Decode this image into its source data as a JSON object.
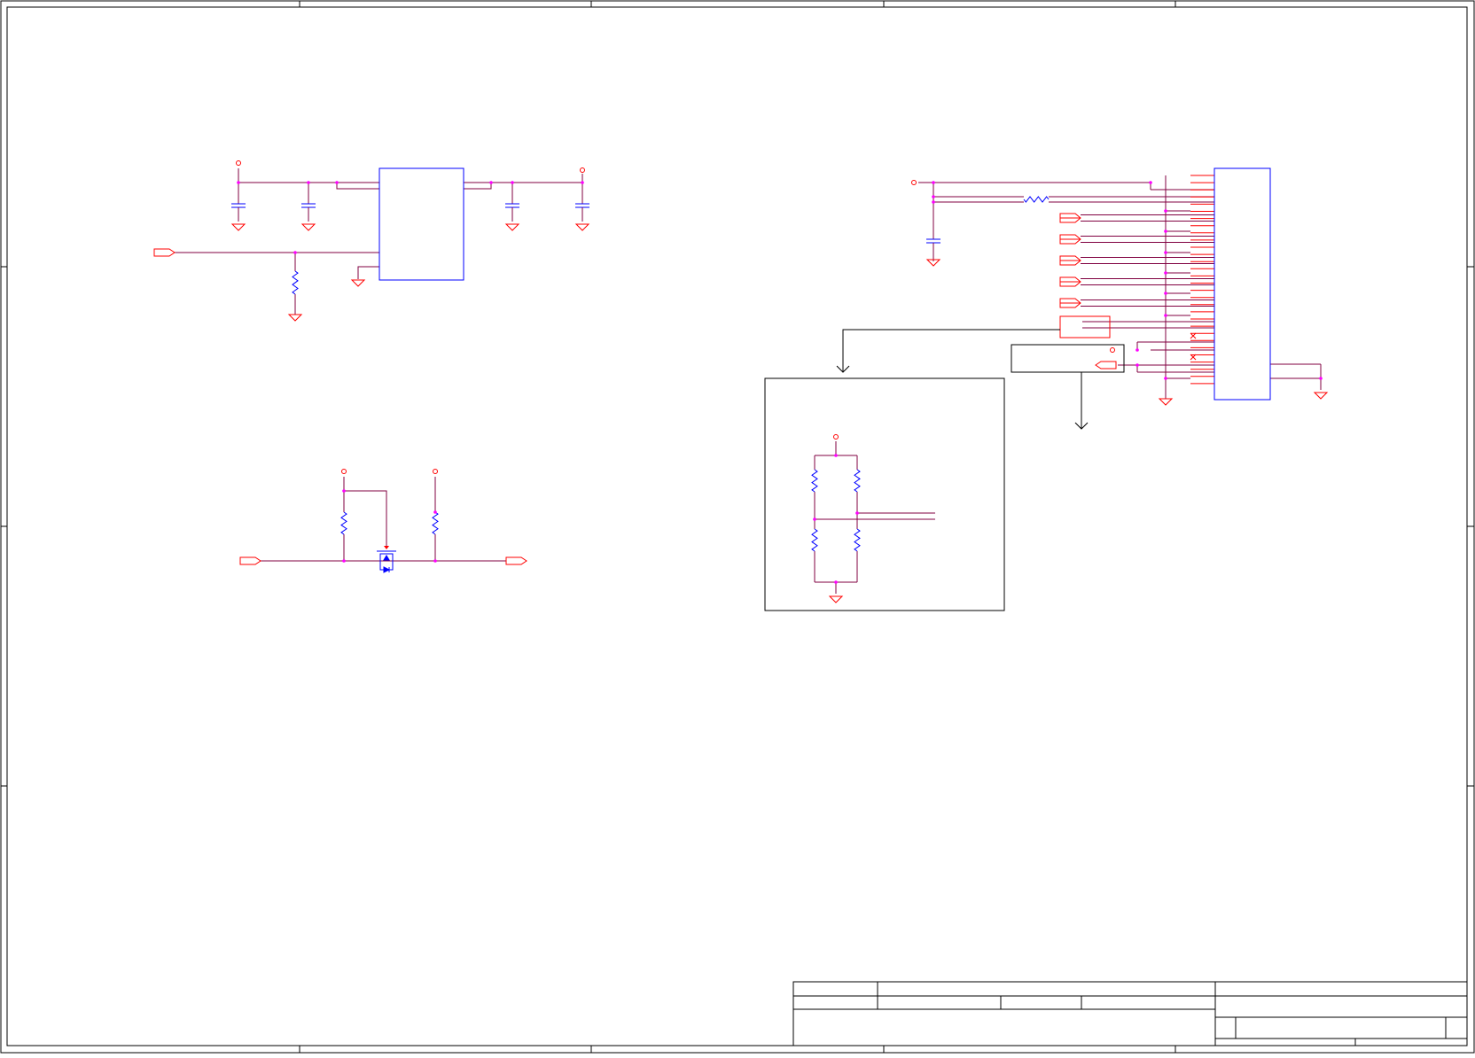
{
  "colors": {
    "frame": "#000000",
    "wire": "#800040",
    "symbol": "#ff0000",
    "component": "#0000ff",
    "junction": "#ff00ff",
    "background": "#ffffff"
  },
  "sheet": {
    "title_block": {
      "title": "",
      "size": "",
      "document_number": "",
      "revision": "",
      "date": "",
      "sheet": ""
    }
  },
  "icons": {
    "ground": "ground-icon",
    "power_port": "power-port-icon",
    "off_sheet_port": "port-arrow-icon",
    "resistor": "resistor-icon",
    "capacitor": "capacitor-icon",
    "mosfet": "mosfet-icon"
  }
}
